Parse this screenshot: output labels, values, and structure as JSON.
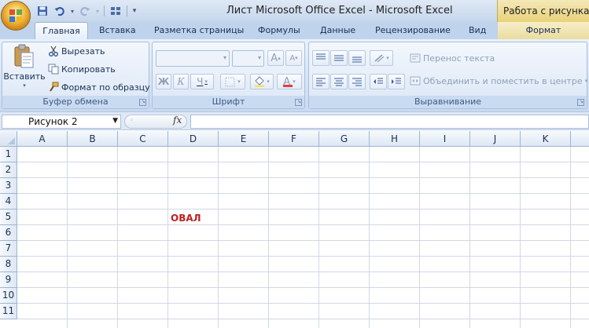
{
  "window": {
    "title": "Лист Microsoft Office Excel - Microsoft Excel",
    "context_tab_title": "Работа с рисунками"
  },
  "tabs": [
    "Главная",
    "Вставка",
    "Разметка страницы",
    "Формулы",
    "Данные",
    "Рецензирование",
    "Вид"
  ],
  "context_tab": "Формат",
  "ribbon": {
    "clipboard": {
      "label": "Буфер обмена",
      "paste": "Вставить",
      "cut": "Вырезать",
      "copy": "Копировать",
      "format_painter": "Формат по образцу"
    },
    "font": {
      "label": "Шрифт",
      "font_name": "",
      "font_size": "",
      "grow": "A",
      "shrink": "A",
      "bold": "Ж",
      "italic": "К",
      "underline": "Ч",
      "font_color": "A"
    },
    "alignment": {
      "label": "Выравнивание",
      "wrap_text": "Перенос текста",
      "merge_center": "Объединить и поместить в центре"
    }
  },
  "formula_bar": {
    "name_box": "Рисунок 2",
    "fx": "fx",
    "formula": ""
  },
  "sheet": {
    "columns": [
      "A",
      "B",
      "C",
      "D",
      "E",
      "F",
      "G",
      "H",
      "I",
      "J",
      "K"
    ],
    "rows": [
      "1",
      "2",
      "3",
      "4",
      "5",
      "6",
      "7",
      "8",
      "9",
      "10",
      "11"
    ],
    "shape_text": "ОВАЛ",
    "shape_text_color": "#c0201e"
  },
  "colors": {
    "ribbon_bg": "#d4e1f3",
    "context_tab": "#eadca0",
    "grid_line": "#d0d7e5"
  }
}
